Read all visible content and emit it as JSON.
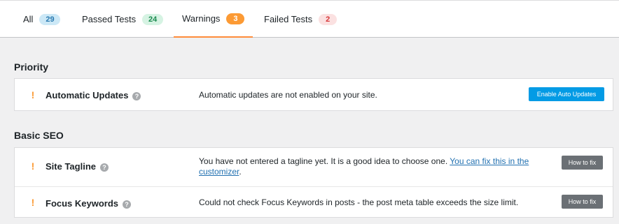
{
  "tabs": [
    {
      "label": "All",
      "count": "29"
    },
    {
      "label": "Passed Tests",
      "count": "24"
    },
    {
      "label": "Warnings",
      "count": "3"
    },
    {
      "label": "Failed Tests",
      "count": "2"
    }
  ],
  "active_tab": "Warnings",
  "sections": [
    {
      "title": "Priority",
      "rows": [
        {
          "title": "Automatic Updates",
          "description": "Automatic updates are not enabled on your site.",
          "button": "Enable Auto Updates"
        }
      ]
    },
    {
      "title": "Basic SEO",
      "rows": [
        {
          "title": "Site Tagline",
          "description": "You have not entered a tagline yet. It is a good idea to choose one.",
          "link_text": "You can fix this in the customizer",
          "link_suffix": ".",
          "button": "How to fix"
        },
        {
          "title": "Focus Keywords",
          "description": "Could not check Focus Keywords in posts - the post meta table exceeds the size limit.",
          "button": "How to fix"
        }
      ]
    }
  ],
  "icons": {
    "warning": "!",
    "help": "?"
  },
  "colors": {
    "warning_accent": "#fc9a34",
    "primary_button": "#039be5",
    "secondary_button": "#6b7075",
    "link": "#2271b1"
  }
}
